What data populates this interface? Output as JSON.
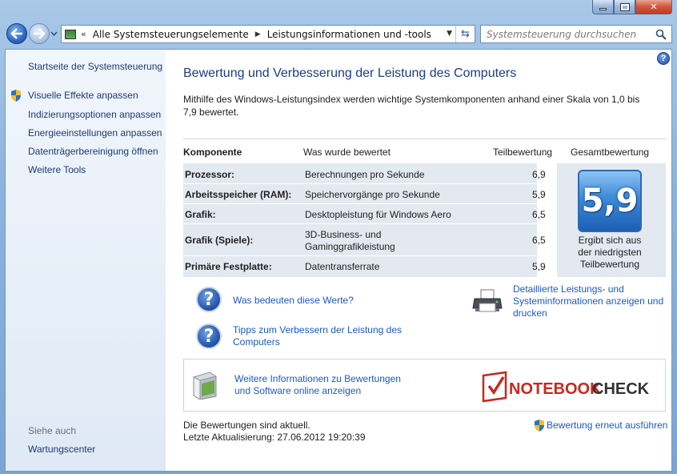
{
  "titlebar": {
    "min_label": "",
    "max_label": "",
    "close_label": "✕"
  },
  "address": {
    "chevron": "«",
    "crumbs": [
      "Alle Systemsteuerungselemente",
      "Leistungsinformationen und -tools"
    ]
  },
  "search": {
    "placeholder": "Systemsteuerung durchsuchen"
  },
  "sidebar": {
    "home": "Startseite der Systemsteuerung",
    "items": [
      "Visuelle Effekte anpassen",
      "Indizierungsoptionen anpassen",
      "Energieeinstellungen anpassen",
      "Datenträgerbereinigung öffnen",
      "Weitere Tools"
    ],
    "see_also": "Siehe auch",
    "see_also_items": [
      "Wartungscenter"
    ]
  },
  "main": {
    "title": "Bewertung und Verbesserung der Leistung des Computers",
    "intro": "Mithilfe des Windows-Leistungsindex werden wichtige Systemkomponenten anhand einer Skala von 1,0 bis 7,9 bewertet.",
    "table": {
      "headers": [
        "Komponente",
        "Was wurde bewertet",
        "Teilbewertung",
        "Gesamtbewertung"
      ],
      "rows": [
        {
          "component": "Prozessor:",
          "what": "Berechnungen pro Sekunde",
          "score": "6,9"
        },
        {
          "component": "Arbeitsspeicher (RAM):",
          "what": "Speichervorgänge pro Sekunde",
          "score": "5,9"
        },
        {
          "component": "Grafik:",
          "what": "Desktopleistung für Windows Aero",
          "score": "6,5"
        },
        {
          "component": "Grafik (Spiele):",
          "what_line1": "3D-Business- und",
          "what_line2": "Gaminggrafikleistung",
          "score": "6,5"
        },
        {
          "component": "Primäre Festplatte:",
          "what": "Datentransferrate",
          "score": "5,9"
        }
      ],
      "overall": "5,9",
      "overall_caption": [
        "Ergibt sich aus",
        "der niedrigsten",
        "Teilbewertung"
      ]
    },
    "links": {
      "meaning": "Was bedeuten diese Werte?",
      "tips_line1": "Tipps zum Verbessern der Leistung des",
      "tips_line2": "Computers",
      "details_line1": "Detaillierte Leistungs- und",
      "details_line2": "Systeminformationen anzeigen und",
      "details_line3": "drucken",
      "online_line1": "Weitere Informationen zu Bewertungen",
      "online_line2": "und Software online anzeigen"
    },
    "logo_text": {
      "part1": "NOTEBOOK",
      "part2": "CHECK"
    },
    "status_line1": "Die Bewertungen sind aktuell.",
    "status_line2": "Letzte Aktualisierung: 27.06.2012 19:20:39",
    "rerun": "Bewertung erneut ausführen"
  },
  "colors": {
    "link": "#1b59c6",
    "title": "#1e3b8a",
    "score_tile": "#3d8ad8",
    "logo_red": "#c8281e"
  }
}
